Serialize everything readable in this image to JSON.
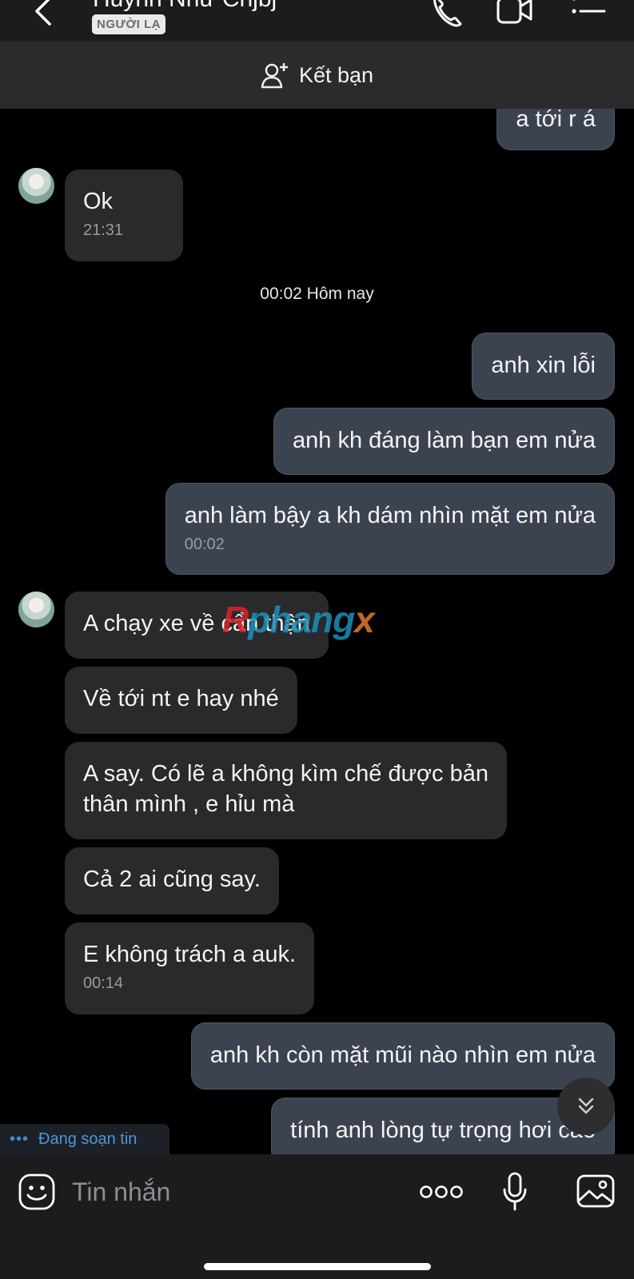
{
  "header": {
    "contact_name": "Huỳnh Như Chjbj",
    "badge": "NGƯỜI LẠ",
    "icons": [
      "back-chevron-icon",
      "phone-icon",
      "video-call-icon",
      "list-menu-icon"
    ]
  },
  "add_friend": {
    "label": "Kết bạn",
    "icon": "add-person-icon"
  },
  "messages": {
    "m1": {
      "text": "a tới r á"
    },
    "m2": {
      "text": "Ok",
      "time": "21:31"
    },
    "date_separator": "00:02 Hôm nay",
    "m3": {
      "text": "anh xin lỗi"
    },
    "m4": {
      "text": "anh kh đáng làm bạn em nửa"
    },
    "m5": {
      "text": "anh làm bậy a kh dám nhìn mặt em nửa",
      "time": "00:02"
    },
    "m6": {
      "text": "A chạy xe về cẩn thận"
    },
    "m7": {
      "text": "Về tới nt e hay nhé"
    },
    "m8": {
      "line1": "A say. Có lẽ a không kìm chế được bản",
      "line2": "thân mình , e hỉu mà"
    },
    "m9": {
      "text": "Cả 2 ai cũng say."
    },
    "m10": {
      "text": "E không trách a auk.",
      "time": "00:14"
    },
    "m11": {
      "text": "anh kh còn mặt mũi nào nhìn em nửa"
    },
    "m12": {
      "text": "tính anh lòng tự trọng hơi cao"
    }
  },
  "watermark": {
    "part1": "R",
    "part2": "phang",
    "part3": "x"
  },
  "typing_indicator": {
    "dots": "•••",
    "label": "Đang soạn tin"
  },
  "input_bar": {
    "placeholder": "Tin nhắn",
    "icons": [
      "emoji-icon",
      "more-icon",
      "microphone-icon",
      "image-icon"
    ]
  },
  "colors": {
    "background": "#000000",
    "header": "#1c1c1e",
    "incoming_bubble": "#2a2a2c",
    "outgoing_bubble": "#3c4350",
    "typing_accent": "#4a9ad8"
  }
}
